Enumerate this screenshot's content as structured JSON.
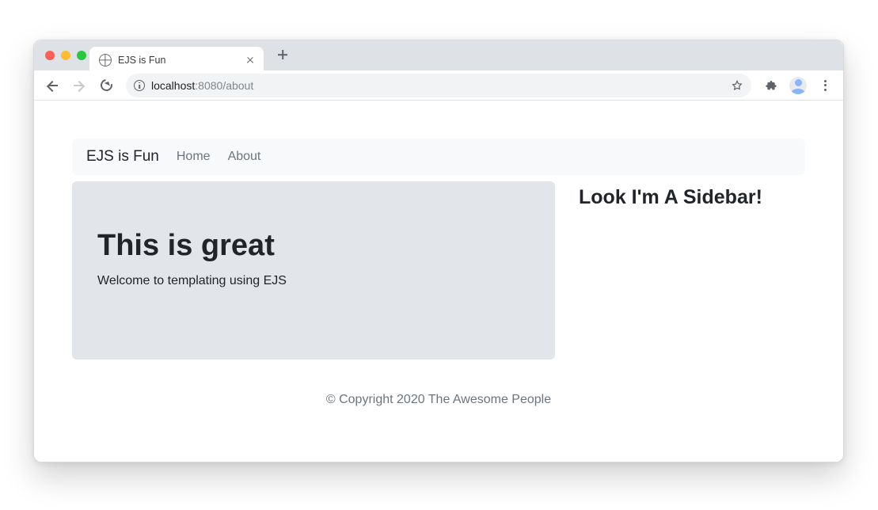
{
  "browser": {
    "tab_title": "EJS is Fun",
    "url_host": "localhost",
    "url_port": ":8080",
    "url_path": "/about"
  },
  "navbar": {
    "brand": "EJS is Fun",
    "links": [
      "Home",
      "About"
    ]
  },
  "jumbo": {
    "heading": "This is great",
    "body": "Welcome to templating using EJS"
  },
  "sidebar": {
    "heading": "Look I'm A Sidebar!"
  },
  "footer": {
    "text": "© Copyright 2020 The Awesome People"
  }
}
